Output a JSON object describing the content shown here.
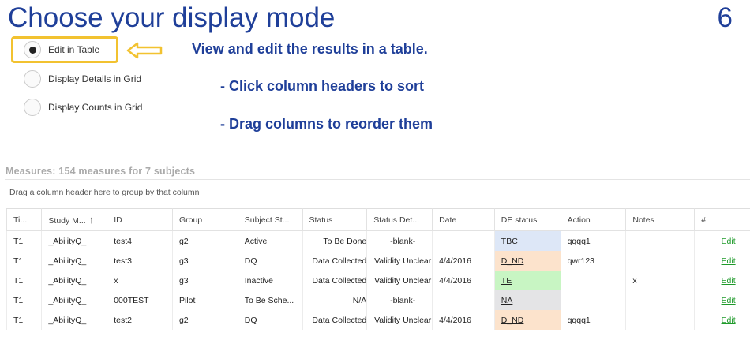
{
  "heading": {
    "title": "Choose your display mode",
    "page_number": "6"
  },
  "display_modes": {
    "options": [
      {
        "label": "Edit in Table",
        "selected": true
      },
      {
        "label": "Display Details in Grid",
        "selected": false
      },
      {
        "label": "Display Counts in Grid",
        "selected": false
      }
    ]
  },
  "annotations": {
    "main": "View and edit the results in a table.",
    "tip1": "- Click column headers to sort",
    "tip2": "- Drag columns to reorder them"
  },
  "grid": {
    "title": "Measures: 154 measures for 7 subjects",
    "group_hint": "Drag a column header here to group by that column",
    "columns": [
      "Ti...",
      "Study M...",
      "ID",
      "Group",
      "Subject St...",
      "Status",
      "Status Det...",
      "Date",
      "DE status",
      "Action",
      "Notes",
      "#"
    ],
    "sort_indicator": "↑",
    "rows": [
      {
        "ti": "T1",
        "study": "_AbilityQ_",
        "id": "test4",
        "group": "g2",
        "subject_status": "Active",
        "status": "To Be Done",
        "status_detail": "-blank-",
        "date": "",
        "de_status": "TBC",
        "de_color": "#dde7f7",
        "action": "qqqq1",
        "notes": "",
        "edit": "Edit"
      },
      {
        "ti": "T1",
        "study": "_AbilityQ_",
        "id": "test3",
        "group": "g3",
        "subject_status": "DQ",
        "status": "Data Collected",
        "status_detail": "Validity Unclear",
        "date": "4/4/2016",
        "de_status": "D_ND",
        "de_color": "#fce3cc",
        "action": "qwr123",
        "notes": "",
        "edit": "Edit"
      },
      {
        "ti": "T1",
        "study": "_AbilityQ_",
        "id": "x",
        "group": "g3",
        "subject_status": "Inactive",
        "status": "Data Collected",
        "status_detail": "Validity Unclear",
        "date": "4/4/2016",
        "de_status": "TE",
        "de_color": "#c8f5c3",
        "action": "",
        "notes": "x",
        "edit": "Edit"
      },
      {
        "ti": "T1",
        "study": "_AbilityQ_",
        "id": "000TEST",
        "group": "Pilot",
        "subject_status": "To Be Sche...",
        "status": "N/A",
        "status_detail": "-blank-",
        "date": "",
        "de_status": "NA",
        "de_color": "#e4e4e6",
        "action": "",
        "notes": "",
        "edit": "Edit"
      },
      {
        "ti": "T1",
        "study": "_AbilityQ_",
        "id": "test2",
        "group": "g2",
        "subject_status": "DQ",
        "status": "Data Collected",
        "status_detail": "Validity Unclear",
        "date": "4/4/2016",
        "de_status": "D_ND",
        "de_color": "#fce3cc",
        "action": "qqqq1",
        "notes": "",
        "edit": "Edit"
      }
    ]
  },
  "colors": {
    "title_blue": "#1f3f99",
    "highlight_yellow": "#f2c230",
    "edit_green": "#1e9a2a"
  }
}
